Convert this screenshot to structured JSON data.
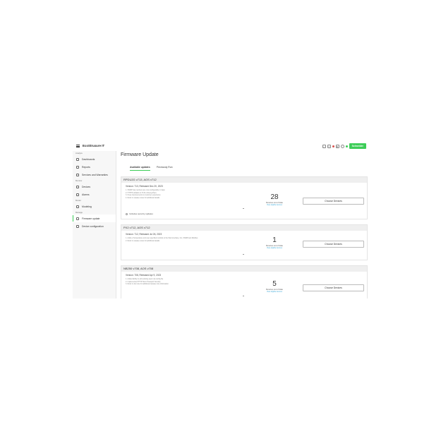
{
  "header": {
    "brand": "EcoStruxure IT",
    "logo": "Schneider",
    "icons": [
      "search-icon",
      "help-icon",
      "bell-icon",
      "settings-icon",
      "user-icon"
    ],
    "accent_color": "#3dcd58"
  },
  "sidebar": {
    "sections": [
      {
        "label": "Analyze",
        "items": [
          {
            "label": "Dashboards",
            "icon": "dashboard-icon"
          },
          {
            "label": "Reports",
            "icon": "report-icon"
          },
          {
            "label": "Services and Warranties",
            "icon": "services-icon"
          }
        ]
      },
      {
        "label": "Monitor",
        "items": [
          {
            "label": "Devices",
            "icon": "device-icon"
          },
          {
            "label": "Alarms",
            "icon": "alarm-icon"
          }
        ]
      },
      {
        "label": "Model",
        "items": [
          {
            "label": "Modeling",
            "icon": "modeling-icon"
          }
        ]
      },
      {
        "label": "Manage",
        "items": [
          {
            "label": "Firmware update",
            "icon": "firmware-icon",
            "active": true
          },
          {
            "label": "Device configuration",
            "icon": "config-icon"
          }
        ]
      }
    ]
  },
  "main": {
    "title": "Firmware Update",
    "tabs": [
      {
        "label": "Available updates",
        "active": true
      },
      {
        "label": "Previously Run",
        "active": false
      }
    ],
    "cards": [
      {
        "title": "RPDU2G v713, AOS v712",
        "version": "Version: 713, Released Dec 20, 2023",
        "notes": [
          "1. SNMP trap numbers are now configurable in traps",
          "2. HTTPS defaults to TLS1.2 Everywhere",
          "3. Fixes improvements to customer experience",
          "4. Refer to release notes for additional details"
        ],
        "security": "Includes security updates",
        "count": "28",
        "count_label": "Devices out of date",
        "link": "View eligible devices",
        "button": "Choose Devices"
      },
      {
        "title": "PX2 v712, AOS v712",
        "version": "Version: 712, Released Jul 26, 2023",
        "notes": [
          "1. Adds a Temperature and user-specified controls to the Web interface, CLI, SNMP and Modbus",
          "2. Refer to release notes for additional details"
        ],
        "security": "",
        "count": "1",
        "count_label": "Devices out of date",
        "link": "View eligible devices",
        "button": "Choose Devices"
      },
      {
        "title": "NB250 v708, AOS v708",
        "version": "Version: 708, Released Apr 9, 2023",
        "notes": [
          "1. Added ability to edit existing users via config file",
          "2. Implemented HTTP Strict Transport Security",
          "3. Refer to doc site for additional release note information"
        ],
        "security": "",
        "count": "5",
        "count_label": "Devices out of date",
        "link": "View eligible devices",
        "button": "Choose Devices"
      }
    ]
  }
}
